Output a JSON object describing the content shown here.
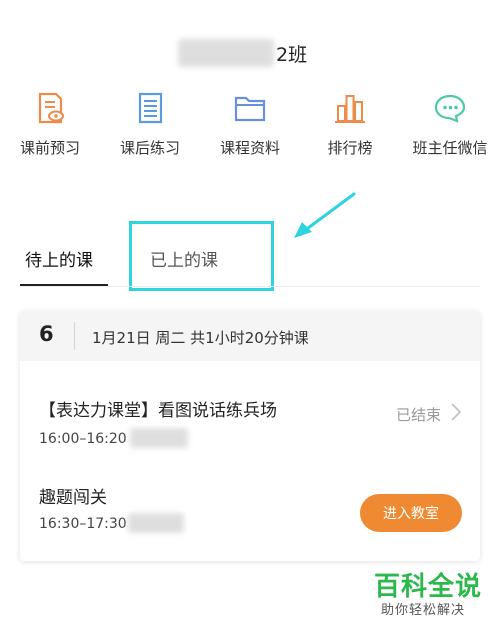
{
  "header": {
    "class_suffix": "2班"
  },
  "nav": [
    {
      "label": "课前预习",
      "icon": "preview-doc-icon",
      "color": "#ee8a4a"
    },
    {
      "label": "课后练习",
      "icon": "exercise-list-icon",
      "color": "#5a9bdc"
    },
    {
      "label": "课程资料",
      "icon": "folder-icon",
      "color": "#6b8fe0"
    },
    {
      "label": "排行榜",
      "icon": "ranking-bars-icon",
      "color": "#ee8a4a"
    },
    {
      "label": "班主任微信",
      "icon": "wechat-icon",
      "color": "#4cc9a8"
    }
  ],
  "tabs": {
    "upcoming": "待上的课",
    "finished": "已上的课"
  },
  "card": {
    "day": "6",
    "date_line": "1月21日 周二 共1小时20分钟课",
    "lessons": [
      {
        "title": "【表达力课堂】看图说话练兵场",
        "time": "16:00–16:20",
        "status": "已结束"
      },
      {
        "title": "趣题闯关",
        "time": "16:30–17:30",
        "action": "进入教室"
      }
    ]
  },
  "colors": {
    "accent": "#ef8a32",
    "highlight": "#2fd3e0",
    "watermark": "#2db84d"
  },
  "watermark": {
    "brand": "百科全说",
    "slogan": "助你轻松解决"
  }
}
